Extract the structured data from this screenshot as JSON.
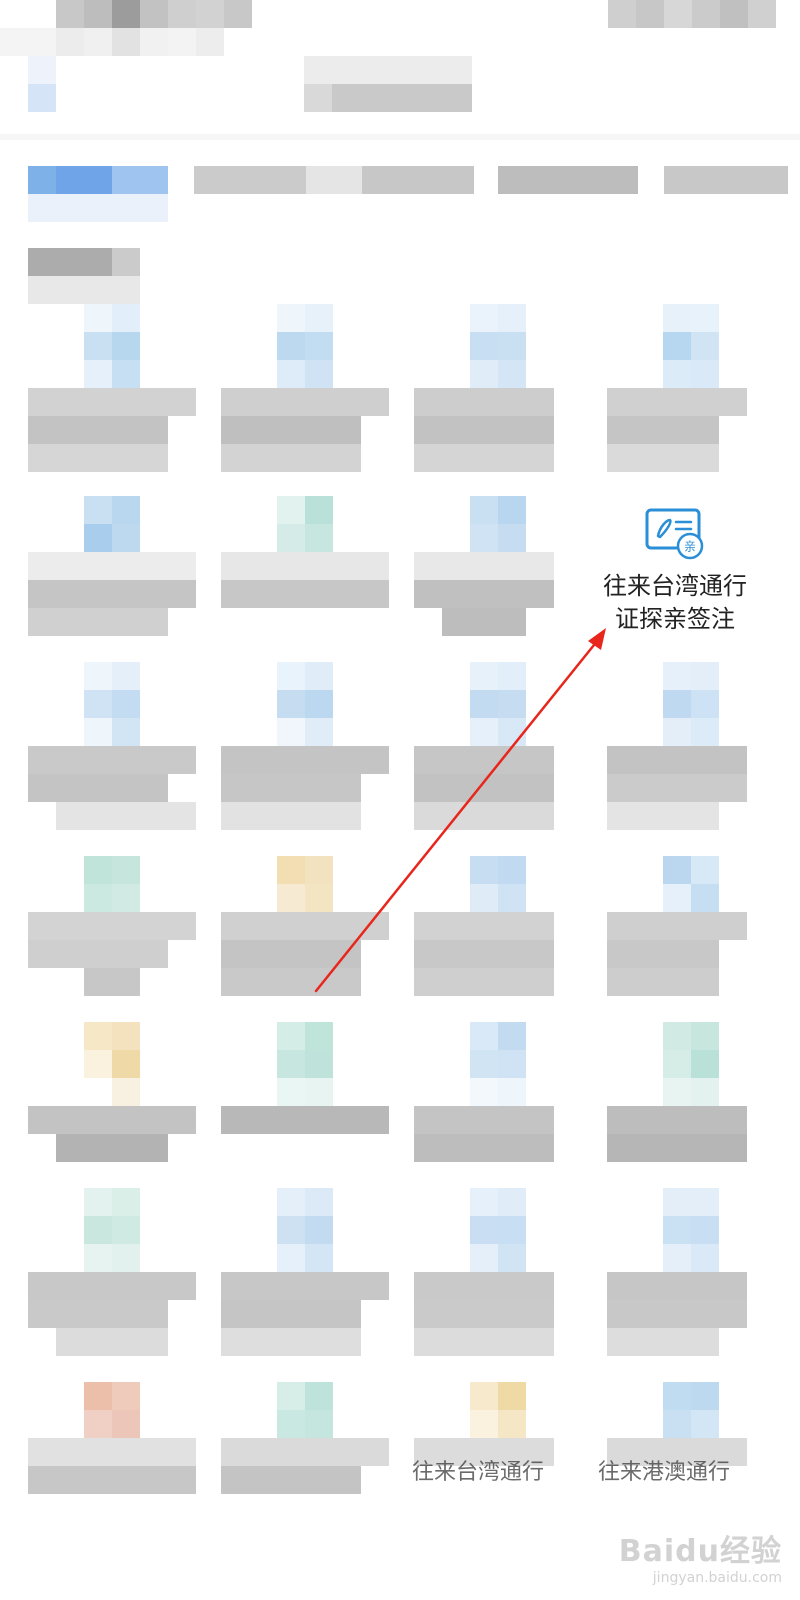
{
  "feature_tile": {
    "icon": "id-card-visit-icon",
    "badge_char": "亲",
    "label_line1": "往来台湾通行",
    "label_line2": "证探亲签注"
  },
  "partial_labels": [
    "往来台湾通行",
    "往来港澳通行"
  ],
  "watermark": {
    "brand": "Baidu经验",
    "url": "jingyan.baidu.com"
  },
  "annotation": {
    "arrow_color": "#e8261c"
  },
  "colors": {
    "accent": "#2a8fd6",
    "text": "#222222"
  }
}
